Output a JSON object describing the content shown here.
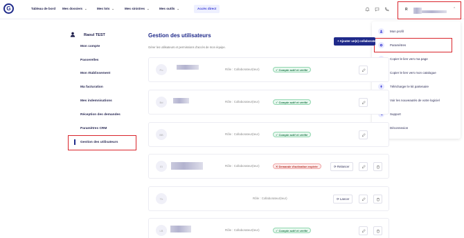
{
  "app": {
    "logo_letter": "G"
  },
  "nav": {
    "items": [
      {
        "label": "Tableau de bord"
      },
      {
        "label": "Mes dossiers"
      },
      {
        "label": "Mes lots"
      },
      {
        "label": "Mes sinistres"
      },
      {
        "label": "Mes outils"
      }
    ],
    "quick_access": "Accès direct"
  },
  "user": {
    "initial": "R",
    "name": "Raoul TEST"
  },
  "user_menu": {
    "items": [
      {
        "label": "Mon profil",
        "icon": "user-icon"
      },
      {
        "label": "Paramètres",
        "icon": "settings-icon"
      },
      {
        "label": "Copier le lien vers ma page",
        "icon": "link-icon"
      },
      {
        "label": "Copier le lien vers mon catalogue",
        "icon": "link-icon"
      },
      {
        "label": "Télécharger le kit partenaire",
        "icon": "rocket-icon"
      },
      {
        "label": "Voir les nouveautés de votre logiciel",
        "icon": "bulb-icon"
      },
      {
        "label": "Support",
        "icon": "phone-icon"
      },
      {
        "label": "Déconnexion",
        "icon": "logout-icon"
      }
    ]
  },
  "sidebar": {
    "items": [
      {
        "label": "Mon compte"
      },
      {
        "label": "Passerelles"
      },
      {
        "label": "Mon établissement"
      },
      {
        "label": "Ma facturation"
      },
      {
        "label": "Mes indemnisations"
      },
      {
        "label": "Réception des demandes"
      },
      {
        "label": "Paramètres CRM"
      },
      {
        "label": "Gestion des utilisateurs"
      }
    ],
    "active_index": 7
  },
  "main": {
    "title": "Gestion des utilisateurs",
    "subtitle": "Gérer les utilisateurs et permissions d'accès de mon équipe.",
    "add_button": "+ Ajouter un(e) collaborateur",
    "users": [
      {
        "initials": "Po",
        "role": "Rôle : Collaborateur(teur)",
        "status": "Compte actif et vérifié",
        "status_type": "ok",
        "action": ""
      },
      {
        "initials": "Bd",
        "role": "Rôle : Collaborateur(teur)",
        "status": "Compte actif et vérifié",
        "status_type": "ok",
        "action": ""
      },
      {
        "initials": "BB",
        "role": "Rôle : Collaborateur(teur)",
        "status": "Compte actif et vérifié",
        "status_type": "ok",
        "action": ""
      },
      {
        "initials": "El",
        "role": "Rôle : Collaborateur(teur)",
        "status": "Demande d'activation expirée",
        "status_type": "err",
        "action": "Relancer"
      },
      {
        "initials": "Th",
        "role": "Rôle : Collaborateur(teur)",
        "status": "",
        "status_type": "none",
        "action": "Lancer"
      },
      {
        "initials": "LB",
        "role": "Rôle : Collaborateur(teur)",
        "status": "Compte actif et vérifié",
        "status_type": "ok",
        "action": ""
      }
    ]
  },
  "colors": {
    "brand": "#1f2a8a",
    "highlight": "#d9232a",
    "ok": "#1e7a4a",
    "error": "#b3261e"
  }
}
